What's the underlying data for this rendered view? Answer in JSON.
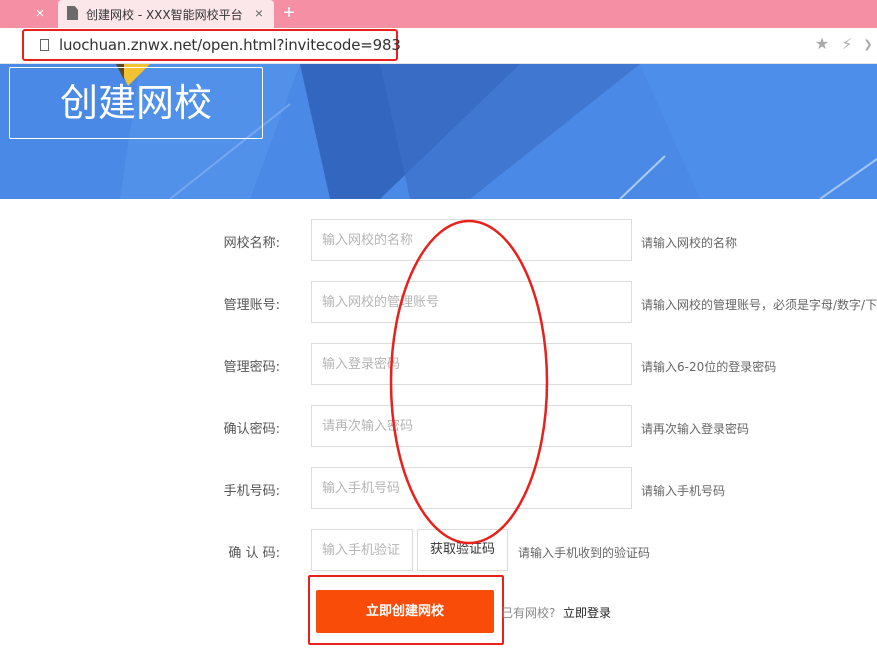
{
  "browser": {
    "tab_title": "创建网校 - XXX智能网校平台",
    "tab_close_glyph": "×",
    "left_close_glyph": "×",
    "new_tab_glyph": "+",
    "url": "luochuan.znwx.net/open.html?invitecode=983",
    "icons": [
      "page-icon",
      "star-icon",
      "bolt-icon",
      "chevron-icon"
    ],
    "star_glyph": "★",
    "bolt_glyph": "⚡",
    "chevron_glyph": "❯"
  },
  "banner": {
    "title": "创建网校",
    "background_color": "#4a8ae6"
  },
  "form": {
    "fields": [
      {
        "label": "网校名称:",
        "placeholder": "输入网校的名称",
        "hint": "请输入网校的名称"
      },
      {
        "label": "管理账号:",
        "placeholder": "输入网校的管理账号",
        "hint": "请输入网校的管理账号，必须是字母/数字/下"
      },
      {
        "label": "管理密码:",
        "placeholder": "输入登录密码",
        "hint": "请输入6-20位的登录密码"
      },
      {
        "label": "确认密码:",
        "placeholder": "请再次输入密码",
        "hint": "请再次输入登录密码"
      },
      {
        "label": "手机号码:",
        "placeholder": "输入手机号码",
        "hint": "请输入手机号码"
      }
    ],
    "verify": {
      "label": "确 认 码:",
      "placeholder": "输入手机验证",
      "button_label": "获取验证码",
      "hint": "请输入手机收到的验证码"
    },
    "submit_label": "立即创建网校",
    "login_prompt": "已有网校?",
    "login_link": "立即登录"
  },
  "colors": {
    "accent_orange": "#fa4c09",
    "annotation_red": "#e8211c",
    "tab_bar": "#f58fa3"
  }
}
